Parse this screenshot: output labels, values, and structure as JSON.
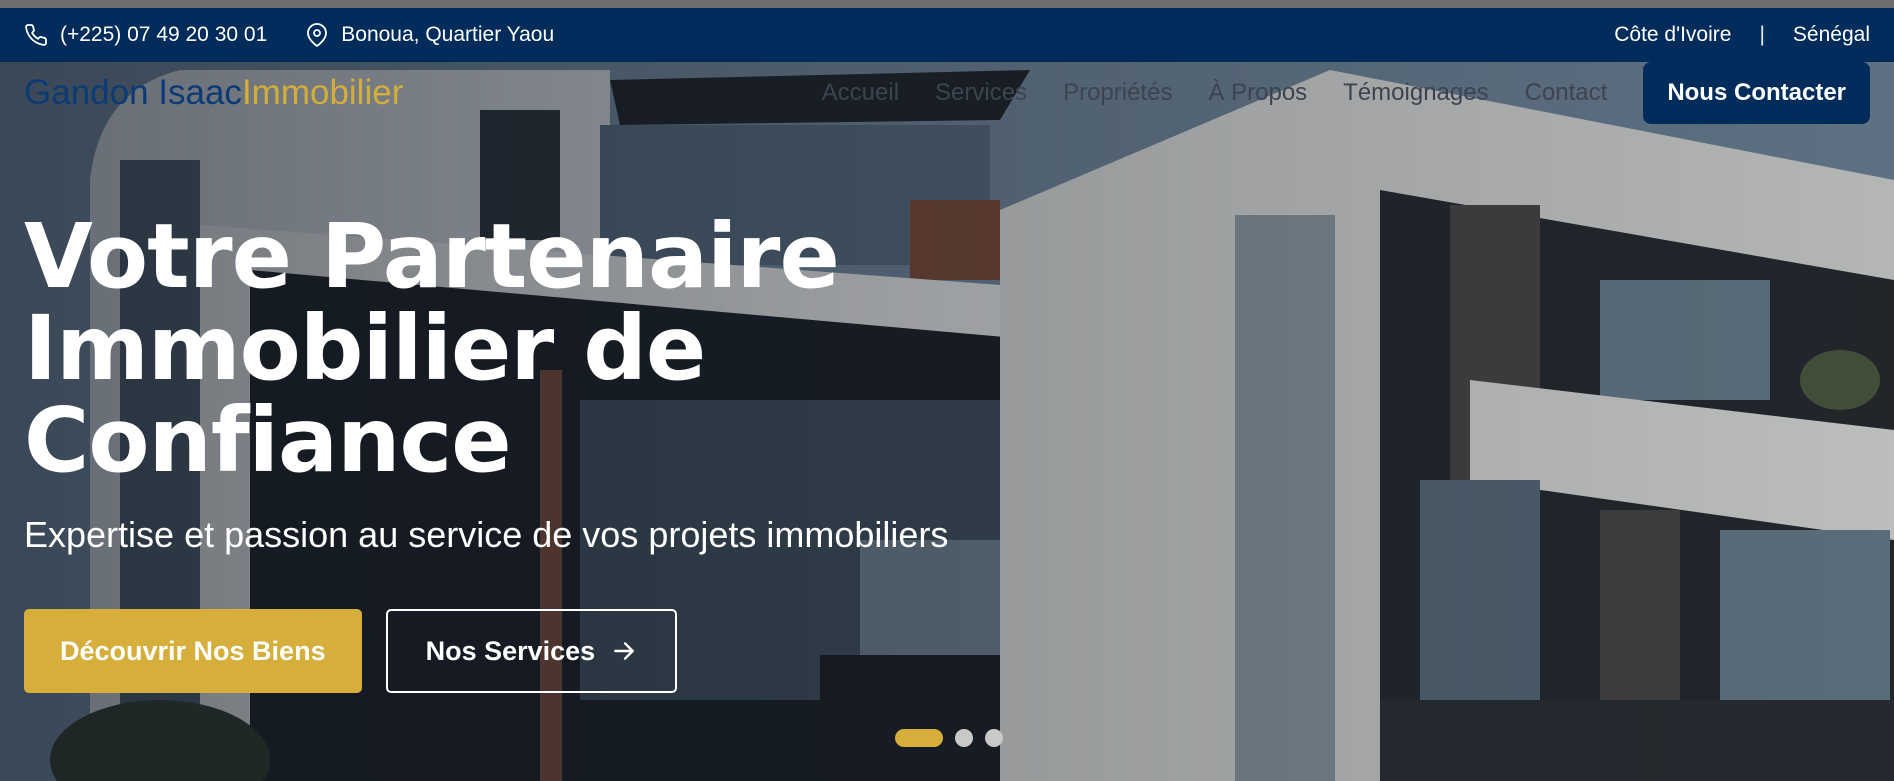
{
  "topbar": {
    "phone": "(+225) 07 49 20 30 01",
    "address": "Bonoua, Quartier Yaou",
    "countries": [
      "Côte d'Ivoire",
      "Sénégal"
    ],
    "separator": "|"
  },
  "navbar": {
    "logo_primary": "Gandon Isaac",
    "logo_secondary": "Immobilier",
    "links": [
      "Accueil",
      "Services",
      "Propriétés",
      "À Propos",
      "Témoignages",
      "Contact"
    ],
    "cta": "Nous Contacter"
  },
  "hero": {
    "headline_lines": [
      "Votre Partenaire",
      "Immobilier de",
      "Confiance"
    ],
    "subheadline": "Expertise et passion au service de vos projets immobiliers",
    "primary_button": "Découvrir Nos Biens",
    "secondary_button": "Nos Services",
    "slides_total": 3,
    "slide_active_index": 0
  },
  "colors": {
    "navy": "#002c5c",
    "gold": "#d5ae3c"
  },
  "icons": {
    "phone": "phone-icon",
    "location": "map-pin-icon",
    "arrow": "arrow-right-icon"
  }
}
